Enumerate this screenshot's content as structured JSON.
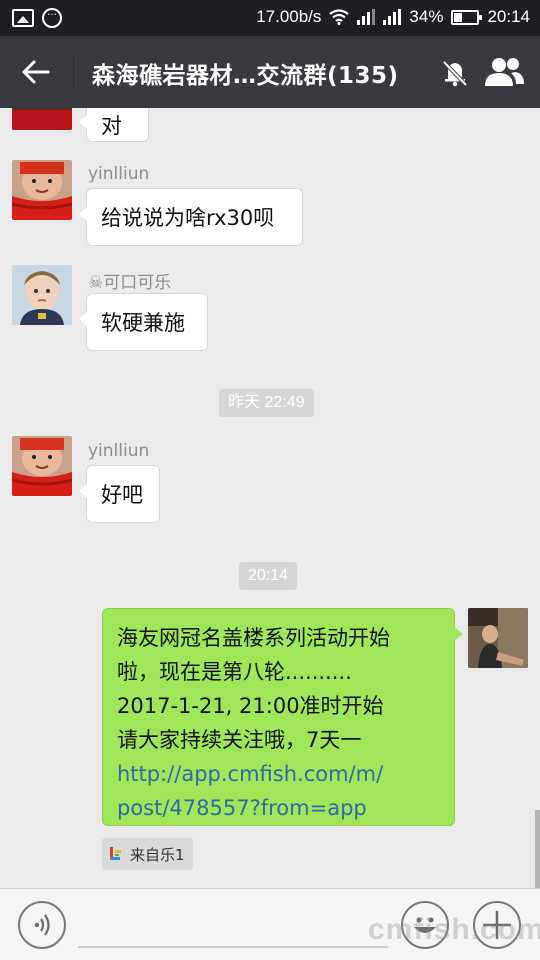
{
  "status_bar": {
    "network_speed": "17.00b/s",
    "battery": "34%",
    "time": "20:14",
    "icons": [
      "image-icon",
      "message-icon",
      "wifi-icon",
      "signal-icon",
      "battery-icon"
    ]
  },
  "header": {
    "title": "森海礁岩器材…交流群(135)",
    "icons": [
      "back-arrow-icon",
      "mute-bell-icon",
      "group-members-icon"
    ]
  },
  "messages": [
    {
      "type": "text",
      "side": "left",
      "text": "对"
    },
    {
      "type": "text",
      "side": "left",
      "sender": "yinlliun",
      "text": "给说说为啥rx30呗"
    },
    {
      "type": "text",
      "side": "left",
      "sender": "☠可口可乐",
      "text": "软硬兼施"
    },
    {
      "type": "time",
      "text": "昨天 22:49"
    },
    {
      "type": "text",
      "side": "left",
      "sender": "yinlliun",
      "text": "好吧"
    },
    {
      "type": "time",
      "text": "20:14"
    },
    {
      "type": "text",
      "side": "right",
      "lines": [
        "海友网冠名盖楼系列活动开始",
        "啦，现在是第八轮..........",
        "2017-1-21, 21:00准时开始",
        "请大家持续关注哦，7天一"
      ],
      "link_lines": [
        "http://app.cmfish.com/m/",
        "post/478557?from=app"
      ],
      "source": "来自乐1"
    }
  ],
  "input_bar": {
    "watermark": "cmfish.com",
    "icons": [
      "voice-icon",
      "emoji-icon",
      "plus-icon"
    ]
  },
  "colors": {
    "status_bar": "#1e1f22",
    "title_bar": "#393a3f",
    "chat_bg": "#ebebeb",
    "own_bubble": "#9fe658",
    "link": "#2d6ca8"
  }
}
